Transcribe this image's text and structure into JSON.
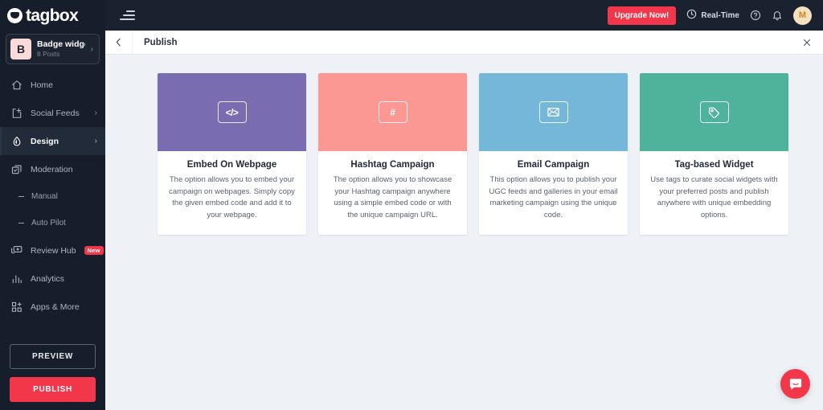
{
  "brand": {
    "logo_text": "tagbox",
    "logo_icon": "tagbox-mark-icon",
    "accent_red": "#f3374b",
    "sidebar_bg": "#171e2b",
    "topbar_bg": "#1a2230",
    "content_bg": "#eef2f6"
  },
  "sidebar": {
    "widget": {
      "avatar_letter": "B",
      "title": "Badge widget",
      "subtitle": "8 Posts",
      "chevron": "›"
    },
    "items": [
      {
        "label": "Home",
        "icon": "home-icon",
        "chevron": "",
        "active": false
      },
      {
        "label": "Social Feeds",
        "icon": "social-feeds-icon",
        "chevron": "›",
        "active": false
      },
      {
        "label": "Design",
        "icon": "design-drop-icon",
        "chevron": "›",
        "active": true
      },
      {
        "label": "Moderation",
        "icon": "moderation-icon",
        "chevron": "",
        "active": false
      }
    ],
    "sub_items": [
      {
        "label": "Manual"
      },
      {
        "label": "Auto Pilot"
      }
    ],
    "items_after": [
      {
        "label": "Review Hub",
        "icon": "review-hub-icon",
        "badge": "New"
      },
      {
        "label": "Analytics",
        "icon": "analytics-icon",
        "badge": ""
      },
      {
        "label": "Apps & More",
        "icon": "apps-more-icon",
        "badge": ""
      }
    ],
    "actions": {
      "preview_label": "PREVIEW",
      "publish_label": "PUBLISH"
    }
  },
  "topbar": {
    "menu_icon": "hamburger-menu-icon",
    "upgrade_label": "Upgrade Now!",
    "realtime_label": "Real-Time",
    "realtime_icon": "clock-icon",
    "help_icon": "help-circle-icon",
    "notifications_icon": "bell-icon",
    "avatar_letter": "M"
  },
  "subbar": {
    "back_icon": "chevron-left-icon",
    "title": "Publish",
    "close_icon": "close-icon"
  },
  "cards": [
    {
      "title": "Embed On Webpage",
      "description": "The option allows you to embed your campaign on webpages. Simply copy the given embed code and add it to your webpage.",
      "color": "#7a6cb0",
      "icon_name": "code-brackets-icon",
      "glyph": "</>"
    },
    {
      "title": "Hashtag Campaign",
      "description": "The option allows you to showcase your Hashtag campaign anywhere using a simple embed code or with the unique campaign URL.",
      "color": "#fc9894",
      "icon_name": "hashtag-icon",
      "glyph": "#"
    },
    {
      "title": "Email Campaign",
      "description": "This option allows you to publish your UGC feeds and galleries in your email marketing campaign using the unique code.",
      "color": "#74b7d9",
      "icon_name": "envelope-icon",
      "glyph": "✉"
    },
    {
      "title": "Tag-based Widget",
      "description": "Use tags to curate social widgets with your preferred posts and publish anywhere with unique embedding options.",
      "color": "#4fb39b",
      "icon_name": "tag-icon",
      "glyph": "◇"
    }
  ],
  "support": {
    "chat_icon": "intercom-chat-icon"
  }
}
